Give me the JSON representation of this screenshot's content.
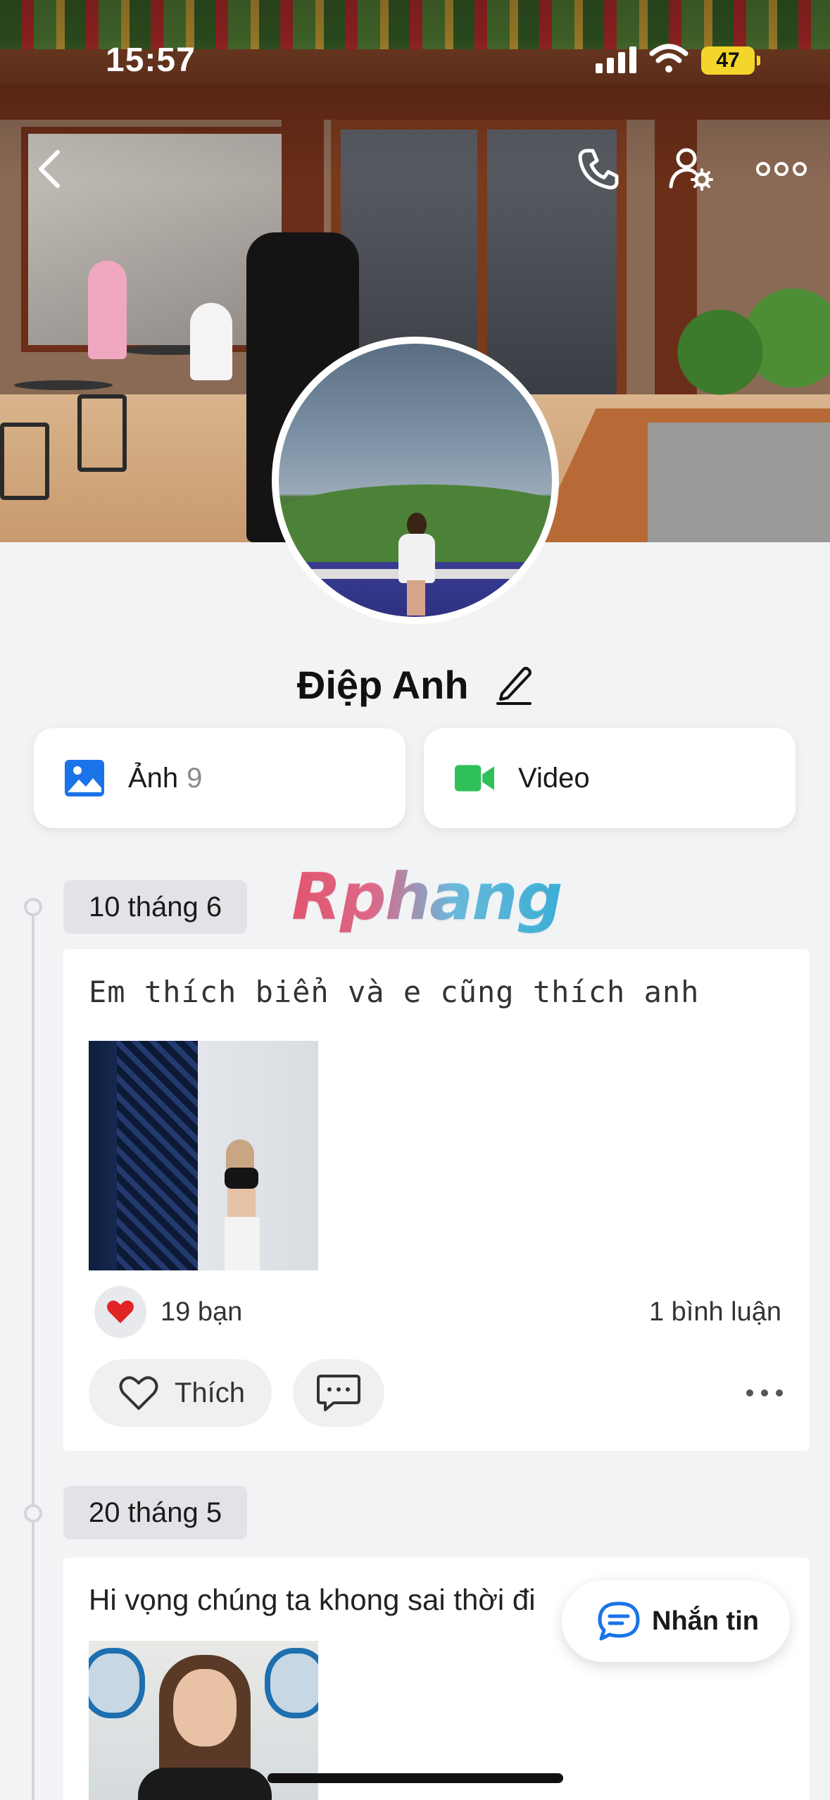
{
  "status_bar": {
    "time": "15:57",
    "battery": "47"
  },
  "nav": {
    "back_icon": "chevron-left-icon",
    "call_icon": "phone-icon",
    "settings_icon": "user-settings-icon",
    "more_icon": "more-dots-icon"
  },
  "profile": {
    "name": "Điệp Anh"
  },
  "media": {
    "photos_label": "Ảnh",
    "photos_count": "9",
    "video_label": "Video"
  },
  "watermark": "Rphang",
  "timeline": [
    {
      "date": "10 tháng 6",
      "text": "Em thích biển và e cũng thích anh",
      "reactions": "19 bạn",
      "comments": "1 bình luận",
      "like_label": "Thích"
    },
    {
      "date": "20 tháng 5",
      "text": "Hi vọng chúng ta khong sai thời đi"
    }
  ],
  "fab": {
    "label": "Nhắn tin"
  },
  "colors": {
    "accent_blue": "#1a73e8",
    "video_green": "#2fc05a",
    "heart_red": "#e02424",
    "background": "#f2f3f5"
  }
}
